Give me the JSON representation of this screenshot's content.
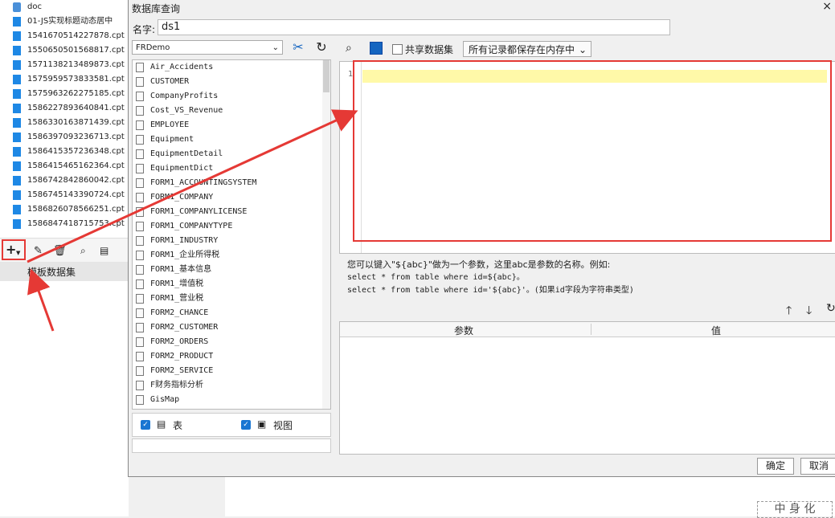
{
  "tree": {
    "folder": "doc",
    "files": [
      "01-JS实现标题动态居中",
      "1541670514227878.cpt",
      "1550650501568817.cpt",
      "1571138213489873.cpt",
      "1575959573833581.cpt",
      "1575963262275185.cpt",
      "1586227893640841.cpt",
      "1586330163871439.cpt",
      "1586397093236713.cpt",
      "1586415357236348.cpt",
      "1586415465162364.cpt",
      "1586742842860042.cpt",
      "1586745143390724.cpt",
      "1586826078566251.cpt",
      "1586847418715753.cpt"
    ],
    "add_label": "+",
    "tab_label": "模板数据集"
  },
  "dialog": {
    "title": "数据库查询",
    "close": "×",
    "name_label": "名字:",
    "name_value": "ds1",
    "connection": "FRDemo",
    "tables": [
      "Air_Accidents",
      "CUSTOMER",
      "CompanyProfits",
      "Cost_VS_Revenue",
      "EMPLOYEE",
      "Equipment",
      "EquipmentDetail",
      "EquipmentDict",
      "FORM1_ACCOUNTINGSYSTEM",
      "FORM1_COMPANY",
      "FORM1_COMPANYLICENSE",
      "FORM1_COMPANYTYPE",
      "FORM1_INDUSTRY",
      "FORM1_企业所得税",
      "FORM1_基本信息",
      "FORM1_增值税",
      "FORM1_营业税",
      "FORM2_CHANCE",
      "FORM2_CUSTOMER",
      "FORM2_ORDERS",
      "FORM2_PRODUCT",
      "FORM2_SERVICE",
      "F财务指标分析",
      "GisMap"
    ],
    "check_table": "表",
    "check_view": "视图",
    "share_label": "共享数据集",
    "memory_option": "所有记录都保存在内存中",
    "line_number": "1",
    "hint_lines": [
      "您可以键入\"${abc}\"做为一个参数，这里abc是参数的名称。例如:",
      "select * from table where id=${abc}。",
      "select * from table where id='${abc}'。(如果id字段为字符串类型)"
    ],
    "param_col": "参数",
    "value_col": "值",
    "ok": "确定",
    "cancel": "取消"
  },
  "background": {
    "stamp": "中 身 化"
  },
  "colors": {
    "annotation": "#e53935",
    "accent": "#1976d2",
    "highlight": "#fff9a8"
  }
}
